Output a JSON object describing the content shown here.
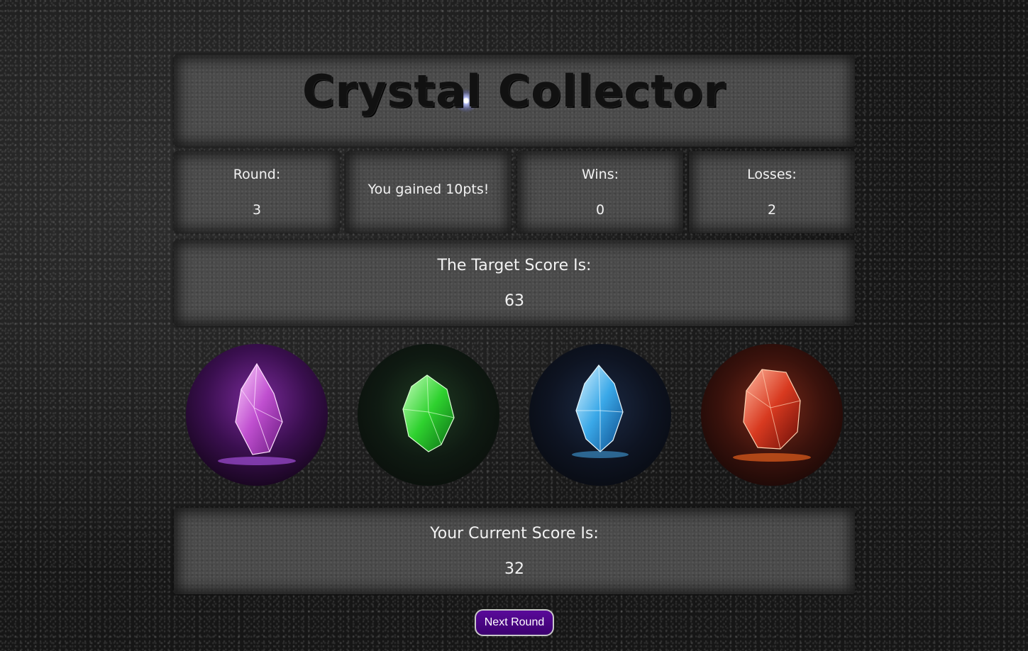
{
  "title": "Crystal Collector",
  "stats": {
    "round_label": "Round:",
    "round_value": "3",
    "message": "You gained 10pts!",
    "wins_label": "Wins:",
    "wins_value": "0",
    "losses_label": "Losses:",
    "losses_value": "2"
  },
  "target": {
    "label": "The Target Score Is:",
    "value": "63"
  },
  "current": {
    "label": "Your Current Score Is:",
    "value": "32"
  },
  "crystals": [
    {
      "name": "purple-crystal",
      "color": "#b040c8"
    },
    {
      "name": "green-crystal",
      "color": "#2fd22f"
    },
    {
      "name": "blue-crystal",
      "color": "#3aa8e8"
    },
    {
      "name": "red-crystal",
      "color": "#d83a20"
    }
  ],
  "next_button_label": "Next Round",
  "colors": {
    "button": "#4a0a88",
    "panel": "#4a4a4a",
    "text": "#f2f2f2"
  }
}
